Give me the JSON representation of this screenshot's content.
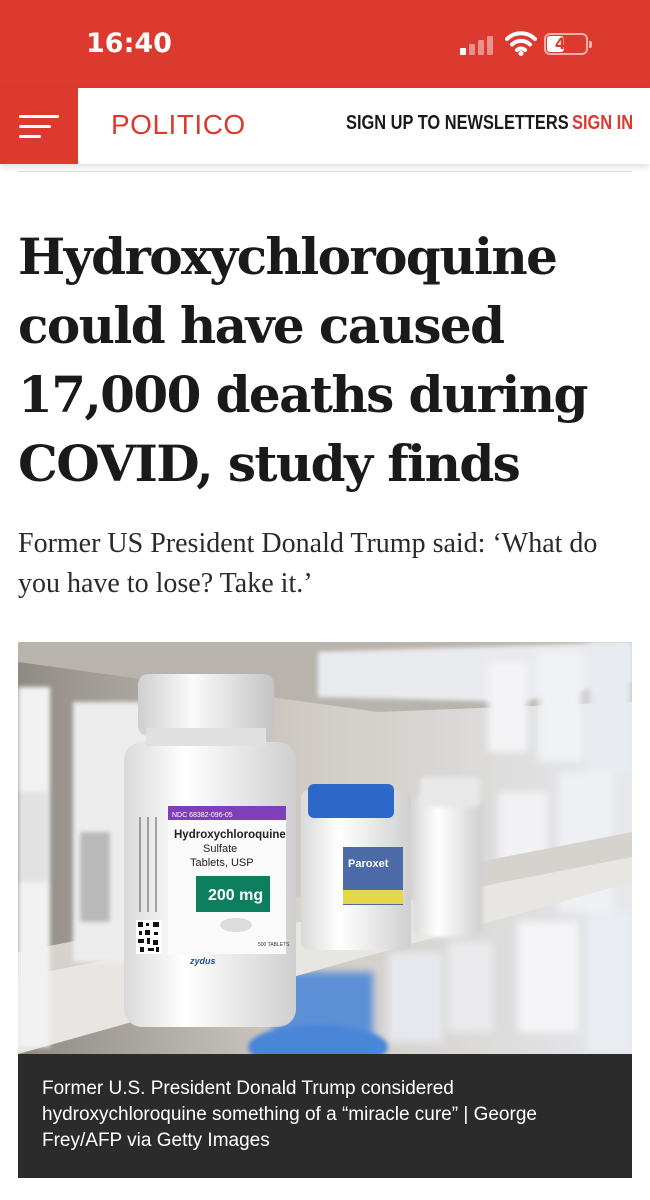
{
  "status_bar": {
    "time": "16:40",
    "battery_level": "44",
    "battery_fraction": 0.44,
    "signal_bars_active": 1,
    "background_color": "#dc3a2e",
    "icons": [
      "signal-icon",
      "wifi-icon",
      "battery-icon"
    ]
  },
  "header": {
    "menu_icon": "hamburger-menu-icon",
    "logo": "POLITICO",
    "newsletter_link": "SIGN UP TO NEWSLETTERS",
    "signin_link": "SIGN IN",
    "accent_color": "#dc3a2e"
  },
  "article": {
    "headline": "Hydroxychloroquine could have caused 17,000 deaths during COVID, study finds",
    "subheadline": "Former US President Donald Trump said: ‘What do you have to lose? Take it.’",
    "photo": {
      "bottle_labels": {
        "ndc": "NDC 68382-096-05",
        "drug_name": "Hydroxychloroquine",
        "drug_form_1": "Sulfate",
        "drug_form_2": "Tablets, USP",
        "dose": "200 mg",
        "count": "500 TABLETS",
        "brand": "zydus"
      }
    },
    "caption": "Former U.S. President Donald Trump considered hydroxychloroquine something of a “miracle cure” | George Frey/AFP via Getty Images"
  }
}
